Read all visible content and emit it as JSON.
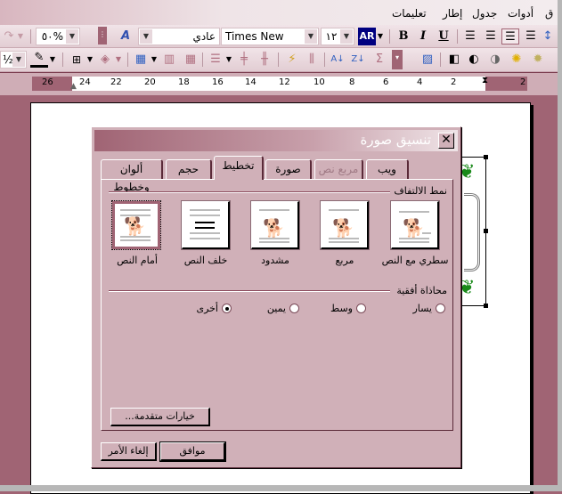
{
  "menubar": {
    "items": [
      "تعليمات",
      "إطار",
      "جدول",
      "أدوات",
      "ق"
    ]
  },
  "toolbar1": {
    "zoom_value": "%٥٠",
    "style_value": "عادي",
    "font_value": "Times New Roman",
    "size_value": "١٢",
    "lang_label": "AR",
    "bold": "B",
    "italic": "I",
    "underline": "U"
  },
  "toolbar2": {
    "line_weight": "½"
  },
  "ruler": {
    "ticks": [
      "26",
      "24",
      "22",
      "20",
      "18",
      "16",
      "14",
      "12",
      "10",
      "8",
      "6",
      "4",
      "2",
      "2"
    ]
  },
  "dialog": {
    "title": "تنسيق صورة",
    "close_label": "✕",
    "tabs": [
      {
        "label": "ألوان وخطوط",
        "state": "normal"
      },
      {
        "label": "حجم",
        "state": "normal"
      },
      {
        "label": "تخطيط",
        "state": "active"
      },
      {
        "label": "صورة",
        "state": "normal"
      },
      {
        "label": "مربع نص",
        "state": "disabled"
      },
      {
        "label": "ويب",
        "state": "normal"
      }
    ],
    "wrap_group_label": "نمط الالتفاف",
    "wrap_styles": [
      {
        "label": "سطري مع النص",
        "selected": false
      },
      {
        "label": "مربع",
        "selected": false
      },
      {
        "label": "مشدود",
        "selected": false
      },
      {
        "label": "خلف النص",
        "selected": false
      },
      {
        "label": "أمام النص",
        "selected": true
      }
    ],
    "align_group_label": "محاذاة أفقية",
    "align_options": [
      {
        "label": "يسار",
        "checked": false
      },
      {
        "label": "وسط",
        "checked": false
      },
      {
        "label": "يمين",
        "checked": false
      },
      {
        "label": "أخرى",
        "checked": true
      }
    ],
    "advanced_button": "خيارات متقدمة...",
    "ok_button": "موافق",
    "cancel_button": "إلغاء الأمر"
  },
  "colors": {
    "accent": "#a06474",
    "dialog_bg": "#d0b0b8",
    "lang_bg": "#000080"
  }
}
